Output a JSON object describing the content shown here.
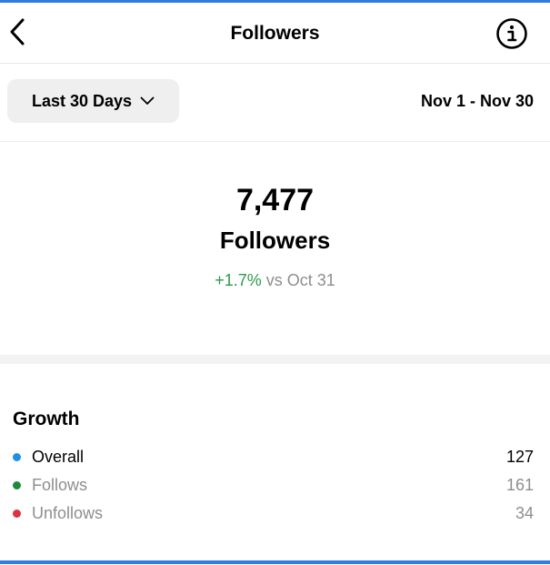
{
  "header": {
    "title": "Followers"
  },
  "range": {
    "selected": "Last 30 Days",
    "date_range": "Nov 1 - Nov 30"
  },
  "summary": {
    "count": "7,477",
    "label": "Followers",
    "change_pct": "+1.7%",
    "change_compare": "vs Oct 31"
  },
  "growth": {
    "title": "Growth",
    "rows": [
      {
        "label": "Overall",
        "value": "127",
        "dot_color": "#1e90e6"
      },
      {
        "label": "Follows",
        "value": "161",
        "dot_color": "#1c8a3a"
      },
      {
        "label": "Unfollows",
        "value": "34",
        "dot_color": "#e0323e"
      }
    ]
  },
  "icons": {
    "back": "chevron-left-icon",
    "info": "info-icon",
    "dropdown": "chevron-down-icon"
  },
  "colors": {
    "accent": "#2f7de1",
    "positive": "#2e9a4b",
    "muted": "#8e8e8e"
  }
}
